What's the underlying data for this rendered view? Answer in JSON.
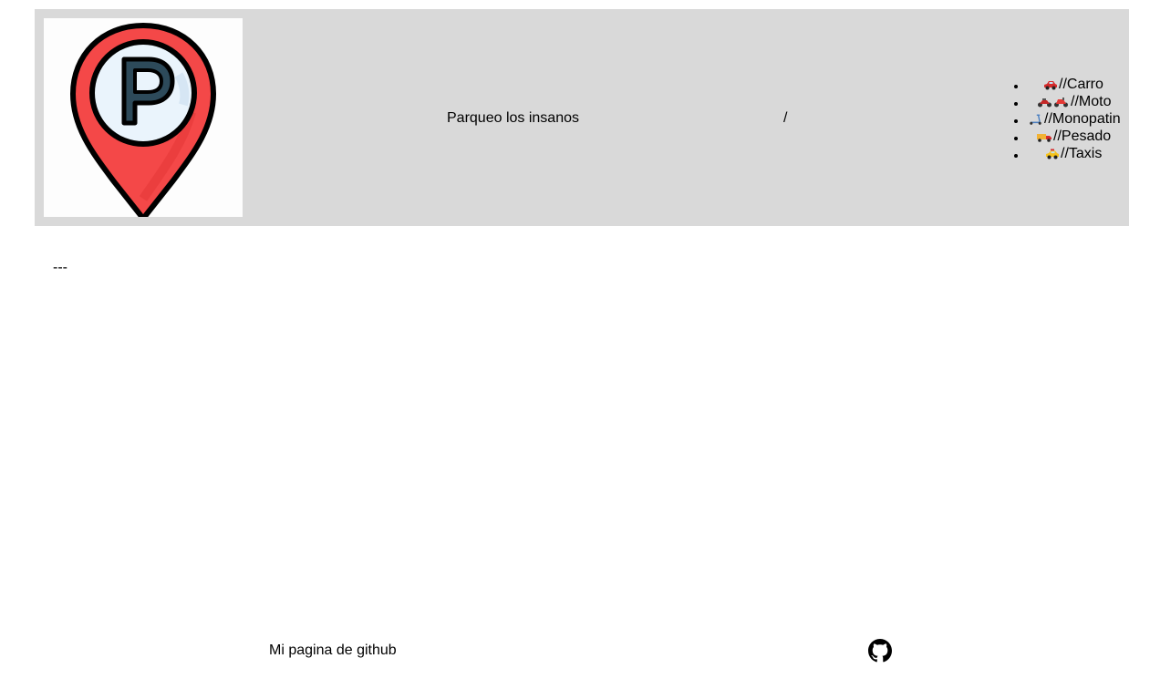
{
  "header": {
    "logo_icon": "parking-location-pin-icon",
    "title": "Parqueo los insanos",
    "separator": "/",
    "nav": [
      {
        "icon": "car-icon",
        "label": "//Carro"
      },
      {
        "icon": "motorcycle-icon",
        "label": "//Moto"
      },
      {
        "icon": "scooter-icon",
        "label": "//Monopatin"
      },
      {
        "icon": "truck-icon",
        "label": "//Pesado"
      },
      {
        "icon": "taxi-icon",
        "label": "//Taxis"
      }
    ]
  },
  "main": {
    "divider": "---"
  },
  "footer": {
    "github_link": "Mi pagina de github",
    "github_icon": "github-icon"
  },
  "colors": {
    "header_bg": "#d9d9d9",
    "pin_red": "#f44848",
    "pin_inner": "#eaf4fc",
    "letter_fill": "#2d4a5a"
  }
}
